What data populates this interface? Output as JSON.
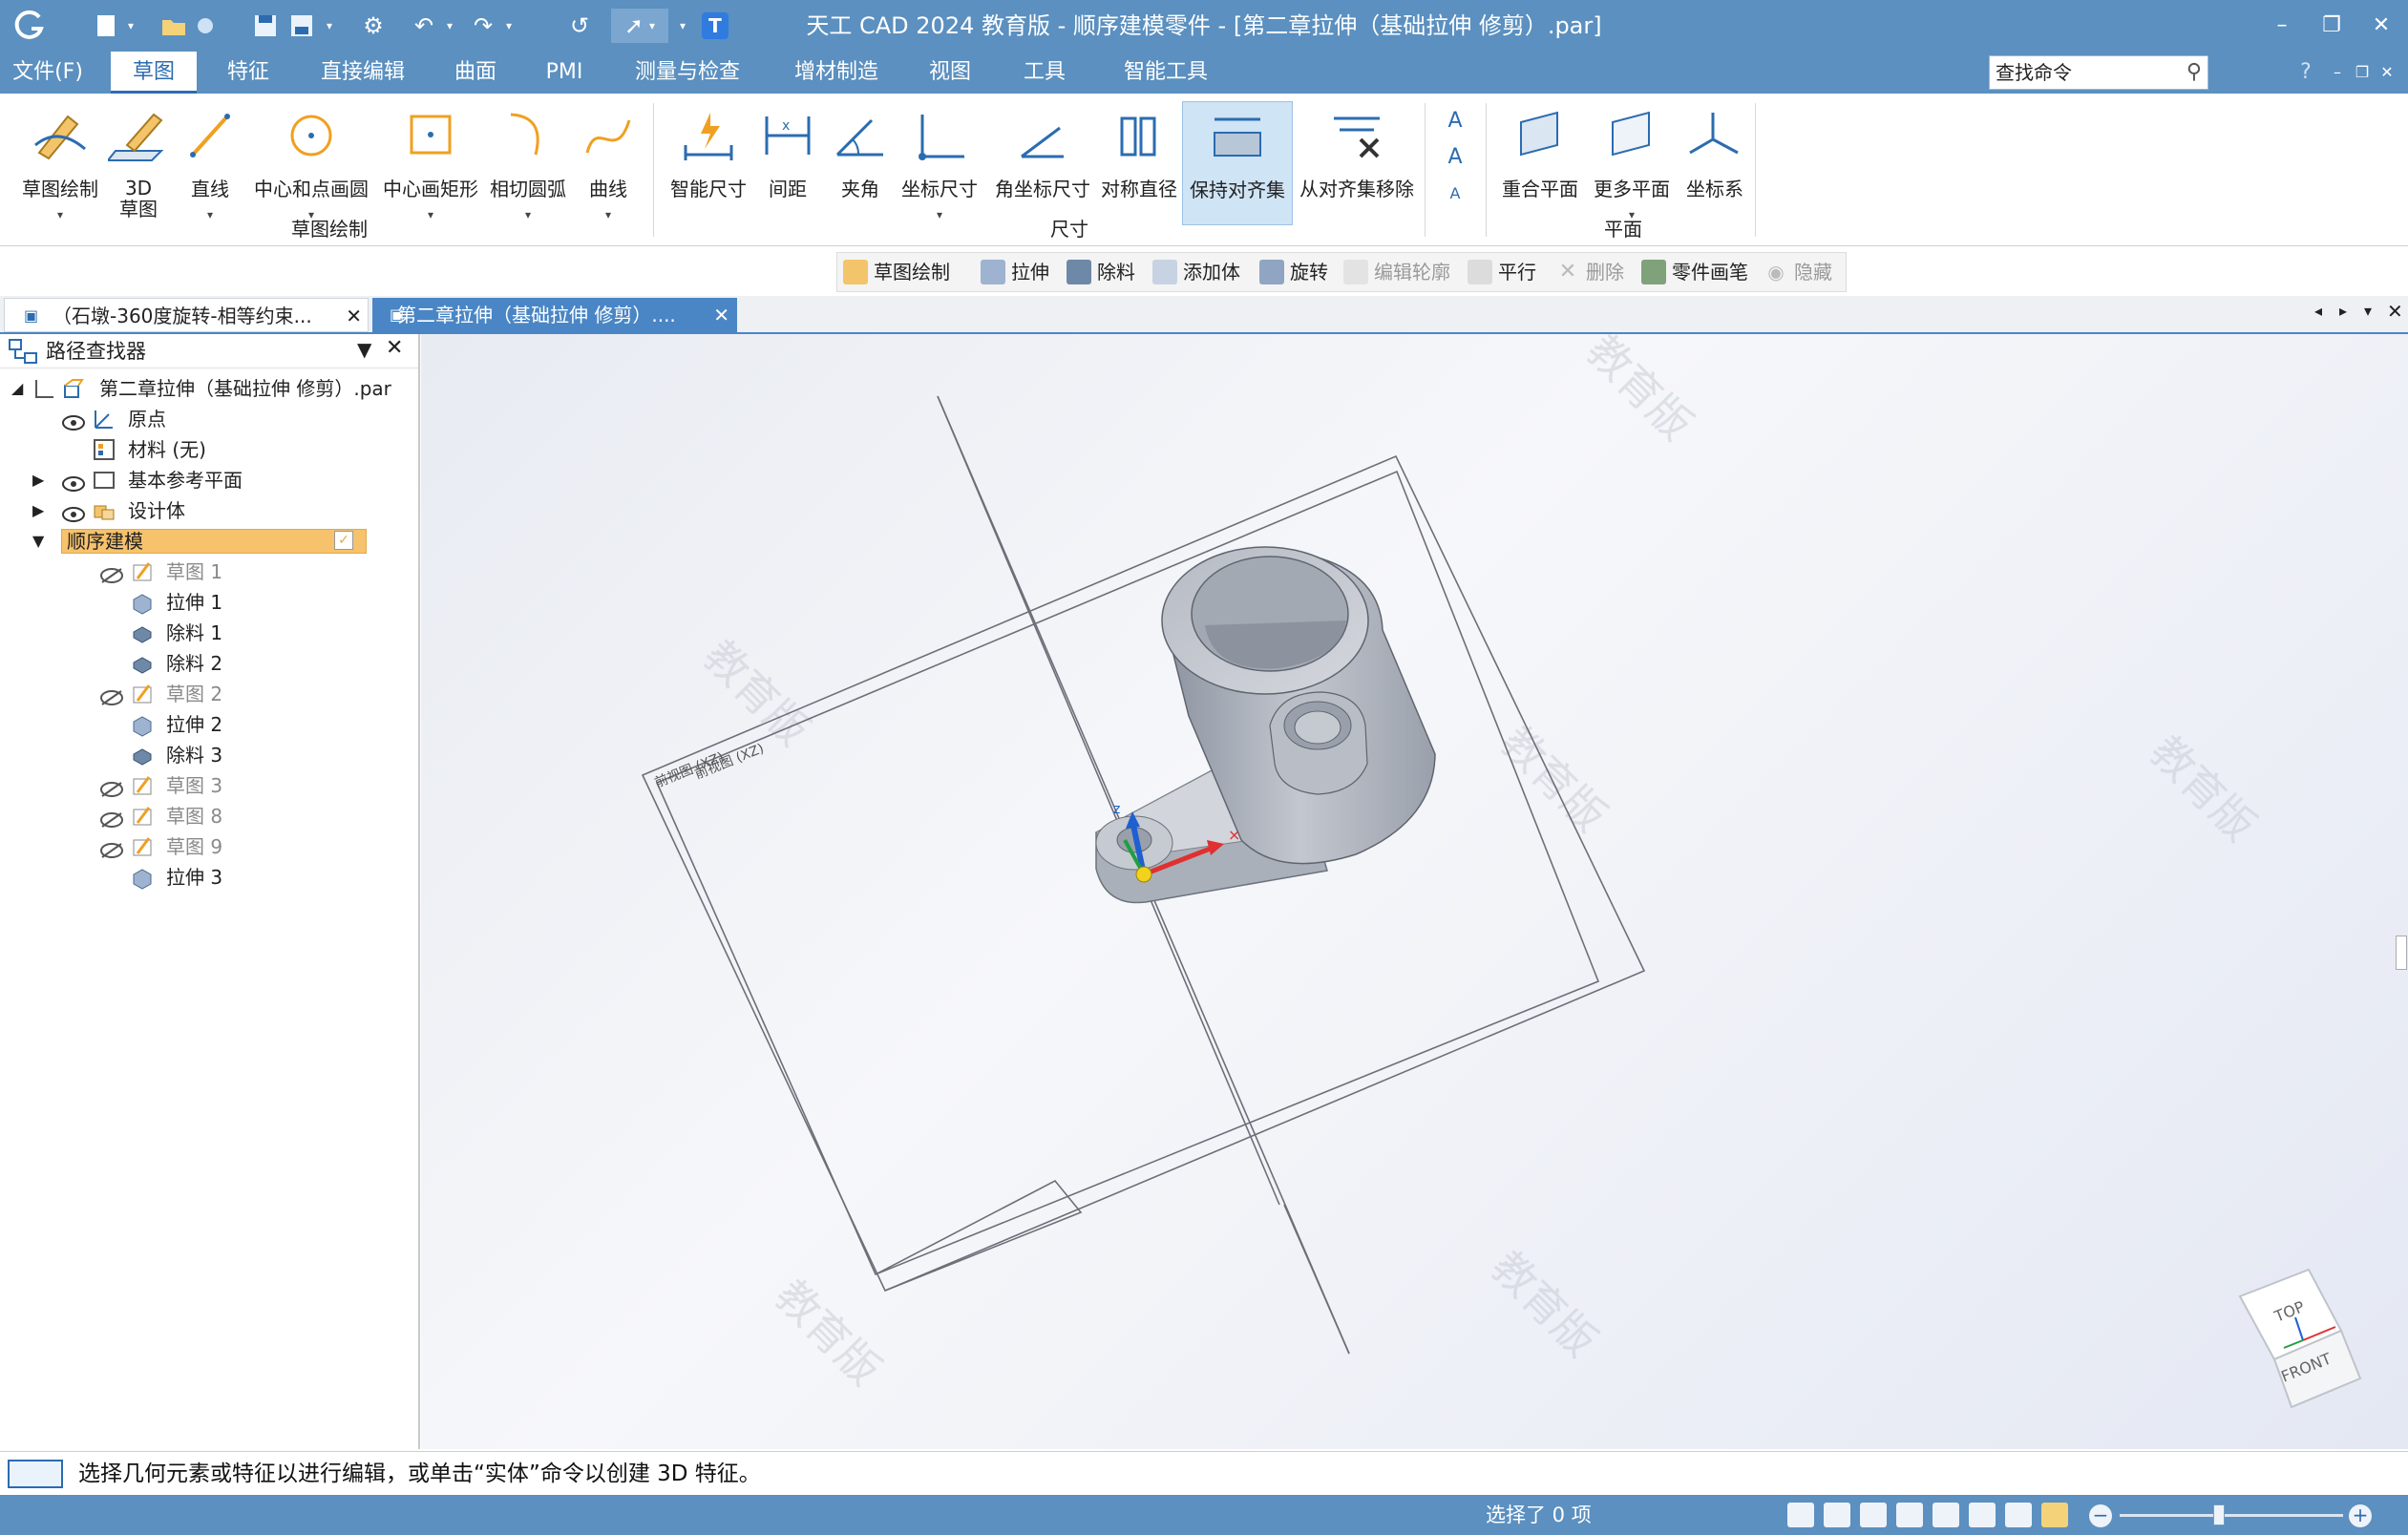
{
  "window": {
    "title": "天工 CAD 2024 教育版 - 顺序建模零件 - [第二章拉伸（基础拉伸 修剪）.par]"
  },
  "quick_access": {
    "icons": [
      "app-logo-icon",
      "new-file-icon",
      "open-file-icon",
      "save-icon",
      "save-as-icon",
      "settings-icon",
      "undo-icon",
      "redo-icon",
      "undo-history-icon",
      "select-cursor-icon",
      "text-t-icon"
    ]
  },
  "menu": {
    "items": [
      "文件(F)",
      "草图",
      "特征",
      "直接编辑",
      "曲面",
      "PMI",
      "测量与检查",
      "增材制造",
      "视图",
      "工具",
      "智能工具"
    ],
    "active": "草图"
  },
  "search": {
    "placeholder": "查找命令"
  },
  "ribbon": {
    "groups": [
      {
        "label": "草图绘制"
      },
      {
        "label": "尺寸"
      },
      {
        "label": "平面"
      }
    ],
    "buttons": [
      {
        "label": "草图绘制"
      },
      {
        "label": "3D\n草图"
      },
      {
        "label": "直线"
      },
      {
        "label": "中心和点画圆"
      },
      {
        "label": "中心画矩形"
      },
      {
        "label": "相切圆弧"
      },
      {
        "label": "曲线"
      },
      {
        "label": "智能尺寸"
      },
      {
        "label": "间距"
      },
      {
        "label": "夹角"
      },
      {
        "label": "坐标尺寸"
      },
      {
        "label": "角坐标尺寸"
      },
      {
        "label": "对称直径"
      },
      {
        "label": "保持对齐集"
      },
      {
        "label": "从对齐集移除"
      },
      {
        "label": "重合平面"
      },
      {
        "label": "更多平面"
      },
      {
        "label": "坐标系"
      }
    ]
  },
  "cmdbar": {
    "items": [
      {
        "label": "草图绘制",
        "enabled": true
      },
      {
        "label": "拉伸",
        "enabled": true
      },
      {
        "label": "除料",
        "enabled": true
      },
      {
        "label": "添加体",
        "enabled": true
      },
      {
        "label": "旋转",
        "enabled": true
      },
      {
        "label": "编辑轮廓",
        "enabled": false
      },
      {
        "label": "平行",
        "enabled": true
      },
      {
        "label": "删除",
        "enabled": false
      },
      {
        "label": "零件画笔",
        "enabled": true
      },
      {
        "label": "隐藏",
        "enabled": false
      }
    ]
  },
  "tabs": [
    {
      "label": "（石墩-360度旋转-相等约束..."
    },
    {
      "label": "第二章拉伸（基础拉伸 修剪）...."
    }
  ],
  "pathfinder": {
    "title": "路径查找器",
    "root": "第二章拉伸（基础拉伸 修剪）.par",
    "nodes": [
      "原点",
      "材料 (无)",
      "基本参考平面",
      "设计体",
      "顺序建模",
      "草图 1",
      "拉伸 1",
      "除料 1",
      "除料 2",
      "草图 2",
      "拉伸 2",
      "除料 3",
      "草图 3",
      "草图 8",
      "草图 9",
      "拉伸 3"
    ]
  },
  "viewport": {
    "plane_label_a": "前视图 (XZ)",
    "plane_label_b": "前视图 (XZ)",
    "watermark": "教育版",
    "view_cube": {
      "top": "TOP",
      "front": "FRONT"
    }
  },
  "status": {
    "prompt": "选择几何元素或特征以进行编辑，或单击“实体”命令以创建 3D 特征。",
    "selection": "选择了 0 项"
  },
  "colors": {
    "titlebar": "#5b90c0",
    "accent": "#2b6cb0",
    "highlight": "#f6c26b",
    "active_button": "#cfe4f5"
  }
}
